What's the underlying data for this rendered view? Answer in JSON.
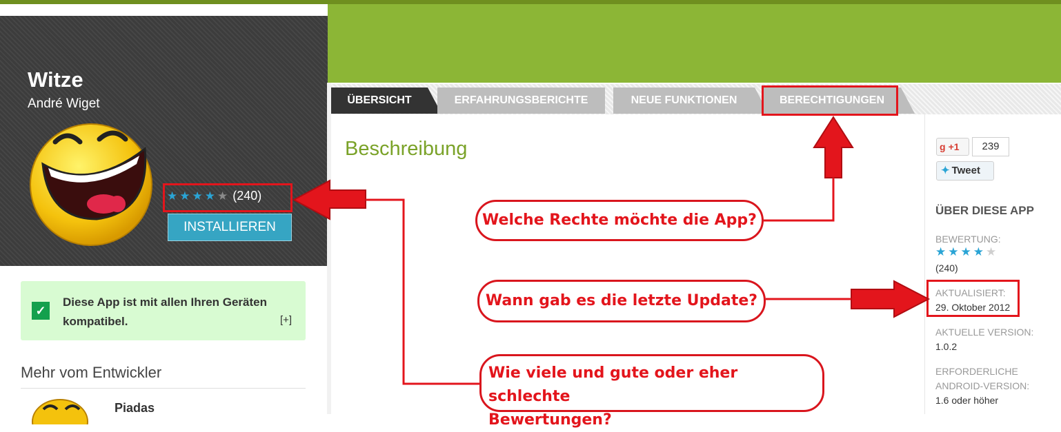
{
  "app": {
    "title": "Witze",
    "developer": "André Wiget",
    "rating_value": 4,
    "rating_max": 5,
    "rating_count": "(240)",
    "install_label": "INSTALLIEREN"
  },
  "compat": {
    "text": "Diese App ist mit allen Ihren Geräten kompatibel.",
    "more": "[+]"
  },
  "more_from_dev": {
    "heading": "Mehr vom Entwickler",
    "items": [
      {
        "title": "Piadas"
      }
    ]
  },
  "tabs": [
    {
      "label": "ÜBERSICHT",
      "active": true
    },
    {
      "label": "ERFAHRUNGSBERICHTE",
      "active": false
    },
    {
      "label": "NEUE FUNKTIONEN",
      "active": false
    },
    {
      "label": "BERECHTIGUNGEN",
      "active": false
    }
  ],
  "main": {
    "section_title": "Beschreibung"
  },
  "social": {
    "gplus_g": "g",
    "gplus_label": "+1",
    "gplus_count": "239",
    "tweet_label": "Tweet"
  },
  "about": {
    "heading": "ÜBER DIESE APP",
    "rating_label": "BEWERTUNG:",
    "rating_count": "(240)",
    "updated_label": "AKTUALISIERT:",
    "updated_value": "29. Oktober 2012",
    "version_label": "AKTUELLE VERSION:",
    "version_value": "1.0.2",
    "android_label_line1": "ERFORDERLICHE",
    "android_label_line2": "ANDROID-VERSION:",
    "android_value": "1.6 oder höher"
  },
  "annotations": {
    "q1": "Welche Rechte möchte die App?",
    "q2": "Wann gab es die letzte Update?",
    "q3_line1": "Wie viele und gute oder eher schlechte",
    "q3_line2": "Bewertungen?"
  },
  "colors": {
    "accent_green": "#8cb636",
    "install_blue": "#36a5c3",
    "annotation_red": "#e3151c",
    "star_blue": "#2aa4d5"
  }
}
